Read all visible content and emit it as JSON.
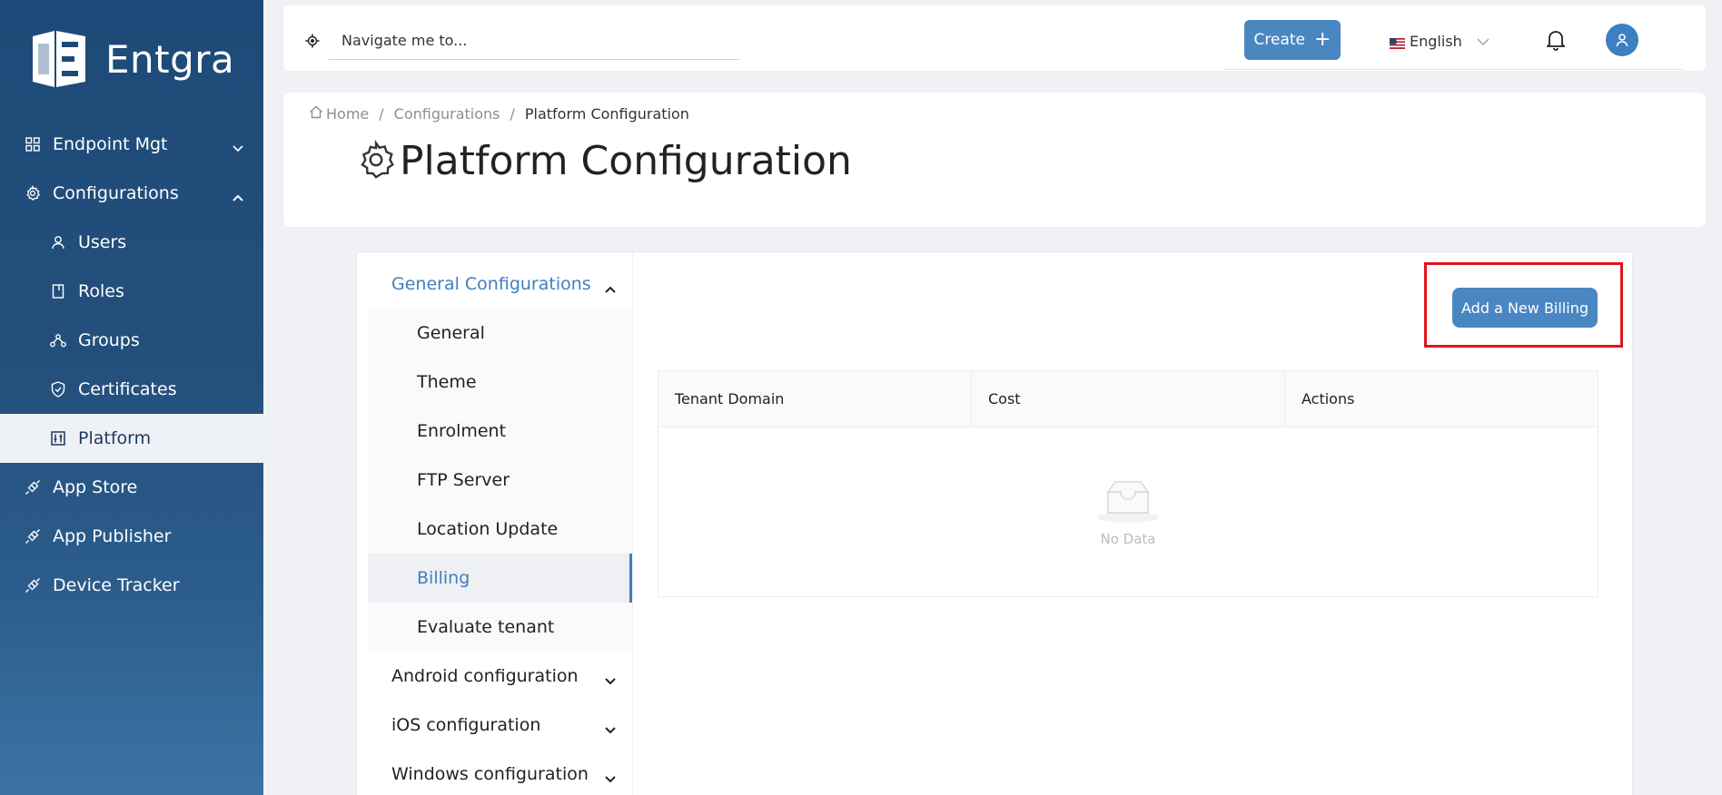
{
  "brand": {
    "name": "Entgra"
  },
  "sidebar": {
    "items": [
      {
        "label": "Endpoint Mgt",
        "icon": "grid-icon",
        "chevron": "down"
      },
      {
        "label": "Configurations",
        "icon": "gear-icon",
        "chevron": "up"
      },
      {
        "label": "Users",
        "icon": "user-icon",
        "sub": true
      },
      {
        "label": "Roles",
        "icon": "book-icon",
        "sub": true
      },
      {
        "label": "Groups",
        "icon": "cluster-icon",
        "sub": true
      },
      {
        "label": "Certificates",
        "icon": "shield-check-icon",
        "sub": true
      },
      {
        "label": "Platform",
        "icon": "control-panel-icon",
        "sub": true,
        "active": true
      },
      {
        "label": "App Store",
        "icon": "api-icon"
      },
      {
        "label": "App Publisher",
        "icon": "api-icon"
      },
      {
        "label": "Device Tracker",
        "icon": "api-icon"
      }
    ]
  },
  "topbar": {
    "search_placeholder": "Navigate me to...",
    "create_label": "Create",
    "language": "English"
  },
  "breadcrumb": {
    "home": "Home",
    "configurations": "Configurations",
    "current": "Platform Configuration"
  },
  "page": {
    "title": "Platform Configuration"
  },
  "config_menu": {
    "general_group": "General Configurations",
    "general_items": [
      "General",
      "Theme",
      "Enrolment",
      "FTP Server",
      "Location Update",
      "Billing",
      "Evaluate tenant"
    ],
    "selected": "Billing",
    "other_groups": [
      "Android configuration",
      "iOS configuration",
      "Windows configuration"
    ]
  },
  "billing": {
    "add_button": "Add a New Billing",
    "columns": [
      "Tenant Domain",
      "Cost",
      "Actions"
    ],
    "empty_text": "No Data"
  },
  "colors": {
    "sidebar_top": "#1d4a78",
    "accent": "#4a87c2",
    "link_active": "#3f7fbf",
    "highlight": "#e0141b"
  }
}
